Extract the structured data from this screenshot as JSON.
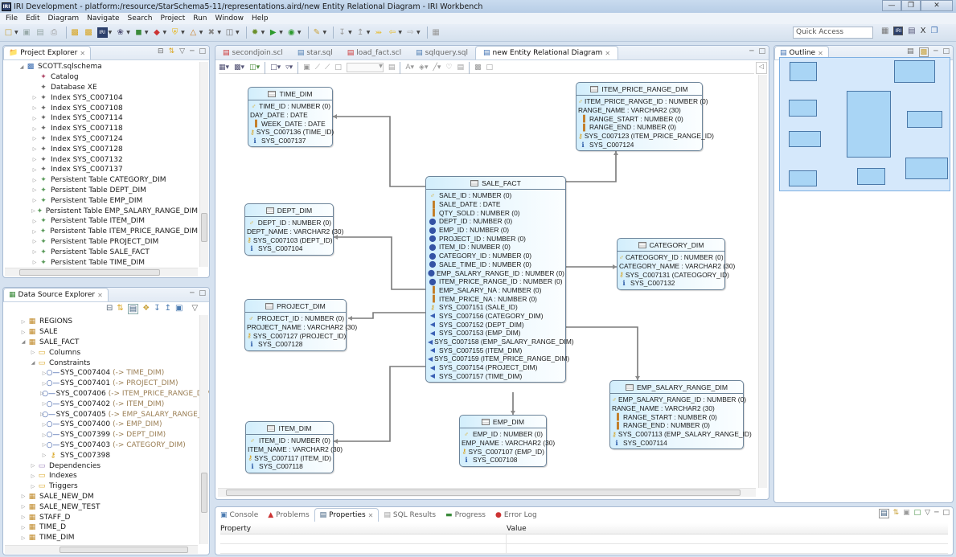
{
  "window": {
    "title": "IRI Development - platform:/resource/StarSchema5-11/representations.aird/new Entity Relational Diagram - IRI Workbench",
    "app_icon": "IRI",
    "controls": [
      "minimize",
      "maximize",
      "close"
    ]
  },
  "menu": [
    "File",
    "Edit",
    "Diagram",
    "Navigate",
    "Search",
    "Project",
    "Run",
    "Window",
    "Help"
  ],
  "toolbar": {
    "icons": [
      "new-icon",
      "save-icon",
      "save-all-icon",
      "print-icon",
      "open-folder-icon",
      "open-folder2-icon",
      "iri-icon",
      "debug-icon",
      "data-icon",
      "sort-icon",
      "shield-icon",
      "figure-icon",
      "tools-icon",
      "flow-icon",
      "bug-icon",
      "run-icon",
      "run-ext-icon",
      "pen-icon",
      "next-annotation-icon",
      "prev-annotation-icon",
      "last-edit-icon",
      "back-icon",
      "forward-icon",
      "pin-icon"
    ],
    "quick_access_placeholder": "Quick Access",
    "perspectives": [
      "open-perspective-icon",
      "iri-perspective-icon",
      "data-perspective-icon",
      "x-icon",
      "java-perspective-icon"
    ]
  },
  "project_explorer": {
    "title": "Project Explorer",
    "root": "SCOTT.sqlschema",
    "items": [
      {
        "label": "Catalog",
        "expandable": false
      },
      {
        "label": "Database XE",
        "expandable": false
      },
      {
        "label": "Index SYS_C007104",
        "expandable": true
      },
      {
        "label": "Index SYS_C007108",
        "expandable": true
      },
      {
        "label": "Index SYS_C007114",
        "expandable": true
      },
      {
        "label": "Index SYS_C007118",
        "expandable": true
      },
      {
        "label": "Index SYS_C007124",
        "expandable": true
      },
      {
        "label": "Index SYS_C007128",
        "expandable": true
      },
      {
        "label": "Index SYS_C007132",
        "expandable": true
      },
      {
        "label": "Index SYS_C007137",
        "expandable": true
      },
      {
        "label": "Persistent Table CATEGORY_DIM",
        "expandable": true
      },
      {
        "label": "Persistent Table DEPT_DIM",
        "expandable": true
      },
      {
        "label": "Persistent Table EMP_DIM",
        "expandable": true
      },
      {
        "label": "Persistent Table EMP_SALARY_RANGE_DIM",
        "expandable": true
      },
      {
        "label": "Persistent Table ITEM_DIM",
        "expandable": true
      },
      {
        "label": "Persistent Table ITEM_PRICE_RANGE_DIM",
        "expandable": true
      },
      {
        "label": "Persistent Table PROJECT_DIM",
        "expandable": true
      },
      {
        "label": "Persistent Table SALE_FACT",
        "expandable": true
      },
      {
        "label": "Persistent Table TIME_DIM",
        "expandable": true
      }
    ]
  },
  "data_source_explorer": {
    "title": "Data Source Explorer",
    "tables_top": [
      "REGIONS",
      "SALE"
    ],
    "expanded_table": "SALE_FACT",
    "folders": {
      "columns": "Columns",
      "constraints": "Constraints",
      "dependencies": "Dependencies",
      "indexes": "Indexes",
      "triggers": "Triggers"
    },
    "constraints": [
      {
        "name": "SYS_C007404",
        "ref": "(-> TIME_DIM)"
      },
      {
        "name": "SYS_C007401",
        "ref": "(-> PROJECT_DIM)"
      },
      {
        "name": "SYS_C007406",
        "ref": "(-> ITEM_PRICE_RANGE_DIM)"
      },
      {
        "name": "SYS_C007402",
        "ref": "(-> ITEM_DIM)"
      },
      {
        "name": "SYS_C007405",
        "ref": "(-> EMP_SALARY_RANGE_DIM)"
      },
      {
        "name": "SYS_C007400",
        "ref": "(-> EMP_DIM)"
      },
      {
        "name": "SYS_C007399",
        "ref": "(-> DEPT_DIM)"
      },
      {
        "name": "SYS_C007403",
        "ref": "(-> CATEGORY_DIM)"
      }
    ],
    "primary_key": "SYS_C007398",
    "tables_bottom": [
      "SALE_NEW_DM",
      "SALE_NEW_TEST",
      "STAFF_D",
      "TIME_D",
      "TIME_DIM"
    ]
  },
  "editor": {
    "tabs": [
      {
        "label": "secondjoin.scl",
        "active": false
      },
      {
        "label": "star.sql",
        "active": false
      },
      {
        "label": "load_fact.scl",
        "active": false
      },
      {
        "label": "sqlquery.sql",
        "active": false
      },
      {
        "label": "new Entity Relational Diagram",
        "active": true
      }
    ]
  },
  "diagram": {
    "entities": {
      "time_dim": {
        "name": "TIME_DIM",
        "rows": [
          {
            "icon": "pk",
            "text": "TIME_ID : NUMBER (0)"
          },
          {
            "icon": "none",
            "text": "DAY_DATE : DATE"
          },
          {
            "icon": "col",
            "text": "WEEK_DATE : DATE"
          },
          {
            "icon": "key",
            "text": "SYS_C007136 (TIME_ID)"
          },
          {
            "icon": "info",
            "text": "SYS_C007137"
          }
        ]
      },
      "dept_dim": {
        "name": "DEPT_DIM",
        "rows": [
          {
            "icon": "pk",
            "text": "DEPT_ID : NUMBER (0)"
          },
          {
            "icon": "none",
            "text": "DEPT_NAME : VARCHAR2 (30)"
          },
          {
            "icon": "key",
            "text": "SYS_C007103 (DEPT_ID)"
          },
          {
            "icon": "info",
            "text": "SYS_C007104"
          }
        ]
      },
      "project_dim": {
        "name": "PROJECT_DIM",
        "rows": [
          {
            "icon": "pk",
            "text": "PROJECT_ID : NUMBER (0)"
          },
          {
            "icon": "none",
            "text": "PROJECT_NAME : VARCHAR2 (30)"
          },
          {
            "icon": "key",
            "text": "SYS_C007127 (PROJECT_ID)"
          },
          {
            "icon": "info",
            "text": "SYS_C007128"
          }
        ]
      },
      "item_dim": {
        "name": "ITEM_DIM",
        "rows": [
          {
            "icon": "pk",
            "text": "ITEM_ID : NUMBER (0)"
          },
          {
            "icon": "none",
            "text": "ITEM_NAME : VARCHAR2 (30)"
          },
          {
            "icon": "key",
            "text": "SYS_C007117 (ITEM_ID)"
          },
          {
            "icon": "info",
            "text": "SYS_C007118"
          }
        ]
      },
      "sale_fact": {
        "name": "SALE_FACT",
        "rows": [
          {
            "icon": "pk",
            "text": "SALE_ID : NUMBER (0)"
          },
          {
            "icon": "col",
            "text": "SALE_DATE : DATE"
          },
          {
            "icon": "col",
            "text": "QTY_SOLD : NUMBER (0)"
          },
          {
            "icon": "fkc",
            "text": "DEPT_ID : NUMBER (0)"
          },
          {
            "icon": "fkc",
            "text": "EMP_ID : NUMBER (0)"
          },
          {
            "icon": "fkc",
            "text": "PROJECT_ID : NUMBER (0)"
          },
          {
            "icon": "fkc",
            "text": "ITEM_ID : NUMBER (0)"
          },
          {
            "icon": "fkc",
            "text": "CATEGORY_ID : NUMBER (0)"
          },
          {
            "icon": "fkc",
            "text": "SALE_TIME_ID : NUMBER (0)"
          },
          {
            "icon": "fkc",
            "text": "EMP_SALARY_RANGE_ID : NUMBER (0)"
          },
          {
            "icon": "fkc",
            "text": "ITEM_PRICE_RANGE_ID : NUMBER (0)"
          },
          {
            "icon": "col",
            "text": "EMP_SALARY_NA : NUMBER (0)"
          },
          {
            "icon": "col",
            "text": "ITEM_PRICE_NA : NUMBER (0)"
          },
          {
            "icon": "key",
            "text": "SYS_C007151 (SALE_ID)"
          },
          {
            "icon": "fkn",
            "text": "SYS_C007156 (CATEGORY_DIM)"
          },
          {
            "icon": "fkn",
            "text": "SYS_C007152 (DEPT_DIM)"
          },
          {
            "icon": "fkn",
            "text": "SYS_C007153 (EMP_DIM)"
          },
          {
            "icon": "fkn",
            "text": "SYS_C007158 (EMP_SALARY_RANGE_DIM)"
          },
          {
            "icon": "fkn",
            "text": "SYS_C007155 (ITEM_DIM)"
          },
          {
            "icon": "fkn",
            "text": "SYS_C007159 (ITEM_PRICE_RANGE_DIM)"
          },
          {
            "icon": "fkn",
            "text": "SYS_C007154 (PROJECT_DIM)"
          },
          {
            "icon": "fkn",
            "text": "SYS_C007157 (TIME_DIM)"
          }
        ]
      },
      "item_price_range_dim": {
        "name": "ITEM_PRICE_RANGE_DIM",
        "rows": [
          {
            "icon": "pk",
            "text": "ITEM_PRICE_RANGE_ID : NUMBER (0)"
          },
          {
            "icon": "none",
            "text": "RANGE_NAME : VARCHAR2 (30)"
          },
          {
            "icon": "col",
            "text": "RANGE_START : NUMBER (0)"
          },
          {
            "icon": "col",
            "text": "RANGE_END : NUMBER (0)"
          },
          {
            "icon": "key",
            "text": "SYS_C007123 (ITEM_PRICE_RANGE_ID)"
          },
          {
            "icon": "info",
            "text": "SYS_C007124"
          }
        ]
      },
      "category_dim": {
        "name": "CATEGORY_DIM",
        "rows": [
          {
            "icon": "pk",
            "text": "CATEOGORY_ID : NUMBER (0)"
          },
          {
            "icon": "none",
            "text": "CATEGORY_NAME : VARCHAR2 (30)"
          },
          {
            "icon": "key",
            "text": "SYS_C007131 (CATEOGORY_ID)"
          },
          {
            "icon": "info",
            "text": "SYS_C007132"
          }
        ]
      },
      "emp_salary_range_dim": {
        "name": "EMP_SALARY_RANGE_DIM",
        "rows": [
          {
            "icon": "pk",
            "text": "EMP_SALARY_RANGE_ID : NUMBER (0)"
          },
          {
            "icon": "none",
            "text": "RANGE_NAME : VARCHAR2 (30)"
          },
          {
            "icon": "col",
            "text": "RANGE_START : NUMBER (0)"
          },
          {
            "icon": "col",
            "text": "RANGE_END : NUMBER (0)"
          },
          {
            "icon": "key",
            "text": "SYS_C007113 (EMP_SALARY_RANGE_ID)"
          },
          {
            "icon": "info",
            "text": "SYS_C007114"
          }
        ]
      },
      "emp_dim": {
        "name": "EMP_DIM",
        "rows": [
          {
            "icon": "pk",
            "text": "EMP_ID : NUMBER (0)"
          },
          {
            "icon": "none",
            "text": "EMP_NAME : VARCHAR2 (30)"
          },
          {
            "icon": "key",
            "text": "SYS_C007107 (EMP_ID)"
          },
          {
            "icon": "info",
            "text": "SYS_C007108"
          }
        ]
      }
    },
    "relations": [
      {
        "from": "SALE_FACT",
        "to": "TIME_DIM"
      },
      {
        "from": "SALE_FACT",
        "to": "DEPT_DIM"
      },
      {
        "from": "SALE_FACT",
        "to": "PROJECT_DIM"
      },
      {
        "from": "SALE_FACT",
        "to": "ITEM_DIM"
      },
      {
        "from": "SALE_FACT",
        "to": "ITEM_PRICE_RANGE_DIM"
      },
      {
        "from": "SALE_FACT",
        "to": "CATEGORY_DIM"
      },
      {
        "from": "SALE_FACT",
        "to": "EMP_SALARY_RANGE_DIM"
      },
      {
        "from": "SALE_FACT",
        "to": "EMP_DIM"
      }
    ]
  },
  "outline": {
    "title": "Outline"
  },
  "bottom": {
    "tabs": [
      {
        "label": "Console",
        "active": false
      },
      {
        "label": "Problems",
        "active": false
      },
      {
        "label": "Properties",
        "active": true
      },
      {
        "label": "SQL Results",
        "active": false
      },
      {
        "label": "Progress",
        "active": false
      },
      {
        "label": "Error Log",
        "active": false
      }
    ],
    "columns": [
      "Property",
      "Value"
    ]
  }
}
